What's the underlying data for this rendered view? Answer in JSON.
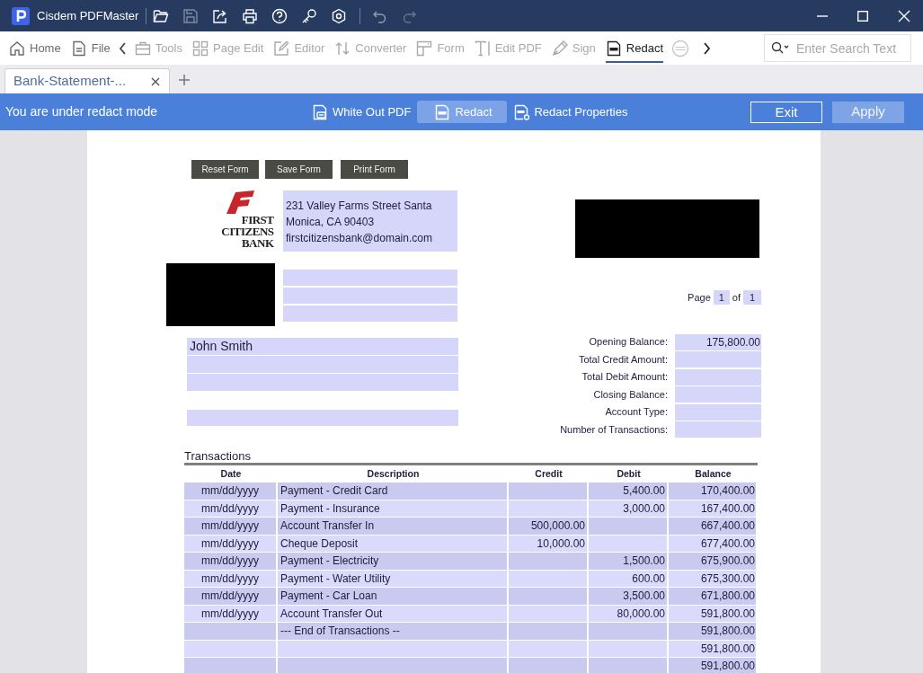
{
  "window": {
    "app_title": "Cisdem PDFMaster"
  },
  "toolbar": {
    "items": [
      {
        "label": "Home",
        "kind": "home",
        "disabled": false,
        "selected": false
      },
      {
        "label": "File",
        "kind": "file",
        "disabled": false,
        "selected": false
      },
      {
        "label": "Tools",
        "kind": "tools",
        "disabled": true,
        "selected": false
      },
      {
        "label": "Page Edit",
        "kind": "grid",
        "disabled": true,
        "selected": false
      },
      {
        "label": "Editor",
        "kind": "editor",
        "disabled": true,
        "selected": false
      },
      {
        "label": "Converter",
        "kind": "convert",
        "disabled": true,
        "selected": false
      },
      {
        "label": "Form",
        "kind": "form",
        "disabled": true,
        "selected": false
      },
      {
        "label": "Edit PDF",
        "kind": "textedit",
        "disabled": true,
        "selected": false
      },
      {
        "label": "Sign",
        "kind": "pen",
        "disabled": true,
        "selected": false
      },
      {
        "label": "Redact",
        "kind": "redact",
        "disabled": false,
        "selected": true
      }
    ]
  },
  "search": {
    "placeholder": "Enter Search Text"
  },
  "tabs": [
    {
      "label": "Bank-Statement-...",
      "selected": true
    }
  ],
  "redact_bar": {
    "message": "You are under redact mode",
    "tools": [
      {
        "label": "White Out PDF",
        "kind": "whiteout",
        "selected": false
      },
      {
        "label": "Redact",
        "kind": "redact",
        "selected": true
      },
      {
        "label": "Redact Properties",
        "kind": "props",
        "selected": false
      }
    ],
    "buttons": [
      {
        "label": "Exit",
        "disabled": false
      },
      {
        "label": "Apply",
        "disabled": true
      }
    ]
  },
  "document": {
    "form_buttons": [
      "Reset Form",
      "Save Form",
      "Print Form"
    ],
    "logo_lines": [
      "FIRST",
      "CITIZENS",
      "BANK"
    ],
    "address": "231 Valley Farms Street Santa Monica, CA 90403",
    "email": "firstcitizensbank@domain.com",
    "name": "John Smith",
    "page": {
      "label": "Page",
      "current": "1",
      "of": "of",
      "total": "1"
    },
    "summary": [
      {
        "label": "Opening Balance:",
        "value": "175,800.00"
      },
      {
        "label": "Total Credit Amount:"
      },
      {
        "label": "Total Debit Amount:"
      },
      {
        "label": "Closing Balance:"
      },
      {
        "label": "Account Type:"
      },
      {
        "label": "Number of Transactions:"
      }
    ],
    "transactions": {
      "title": "Transactions",
      "columns": [
        "Date",
        "Description",
        "Credit",
        "Debit",
        "Balance"
      ],
      "rows": [
        {
          "date": "mm/dd/yyyy",
          "description": "Payment - Credit Card",
          "debit": "5,400.00",
          "balance": "170,400.00"
        },
        {
          "date": "mm/dd/yyyy",
          "description": "Payment - Insurance",
          "debit": "3,000.00",
          "balance": "167,400.00"
        },
        {
          "date": "mm/dd/yyyy",
          "description": "Account Transfer In",
          "credit": "500,000.00",
          "balance": "667,400.00"
        },
        {
          "date": "mm/dd/yyyy",
          "description": "Cheque Deposit",
          "credit": "10,000.00",
          "balance": "677,400.00"
        },
        {
          "date": "mm/dd/yyyy",
          "description": "Payment - Electricity",
          "debit": "1,500.00",
          "balance": "675,900.00"
        },
        {
          "date": "mm/dd/yyyy",
          "description": "Payment - Water Utility",
          "debit": "600.00",
          "balance": "675,300.00"
        },
        {
          "date": "mm/dd/yyyy",
          "description": "Payment - Car Loan",
          "debit": "3,500.00",
          "balance": "671,800.00"
        },
        {
          "date": "mm/dd/yyyy",
          "description": "Account Transfer Out",
          "debit": "80,000.00",
          "balance": "591,800.00"
        },
        {
          "description": "--- End of Transactions --",
          "balance": "591,800.00"
        },
        {
          "balance": "591,800.00"
        },
        {
          "balance": "591,800.00"
        }
      ]
    }
  }
}
